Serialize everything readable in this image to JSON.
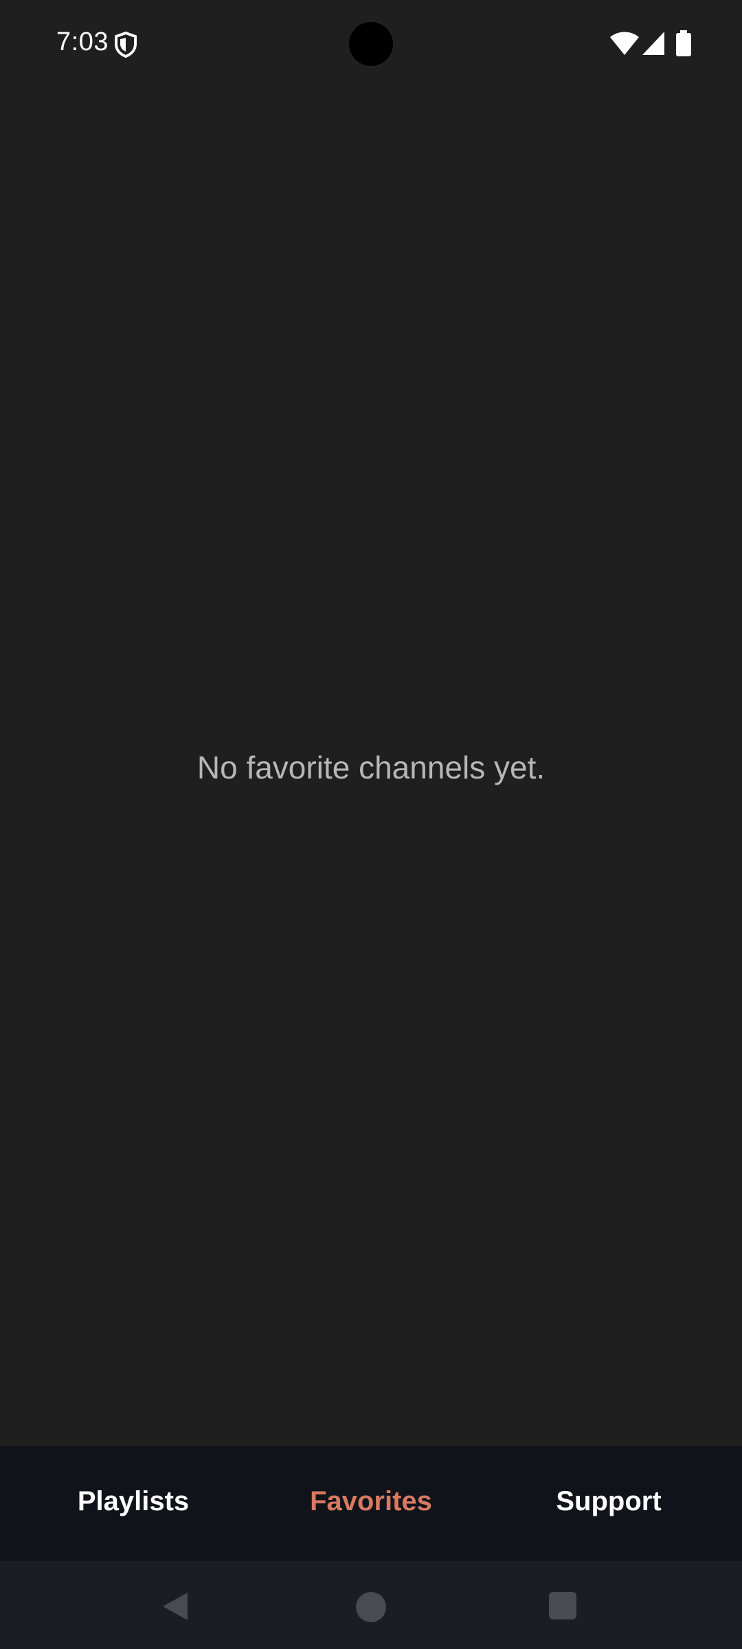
{
  "status_bar": {
    "time": "7:03",
    "icons": [
      "shield-icon",
      "wifi-icon",
      "signal-icon",
      "battery-icon"
    ]
  },
  "main": {
    "empty_message": "No favorite channels yet."
  },
  "bottom_nav": {
    "items": [
      {
        "label": "Playlists",
        "active": false
      },
      {
        "label": "Favorites",
        "active": true
      },
      {
        "label": "Support",
        "active": false
      }
    ],
    "active_color": "#d77a61",
    "text_color": "#ffffff",
    "background": "#11131a"
  },
  "system_nav": {
    "icons": [
      "back-icon",
      "home-icon",
      "recents-icon"
    ]
  },
  "colors": {
    "background": "#1f1f1f",
    "message_text": "#b7b7b7"
  }
}
